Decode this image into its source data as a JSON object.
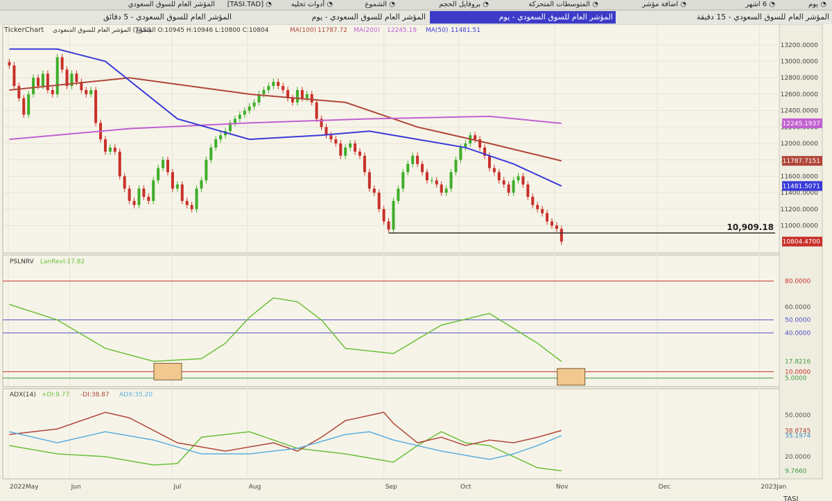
{
  "toolbar": {
    "items": [
      {
        "label": "يوم",
        "icon": "clock-icon"
      },
      {
        "label": "6 اشهر",
        "icon": "range-icon"
      },
      {
        "label": "اضافة مؤشر",
        "icon": "add-indicator-icon"
      },
      {
        "label": "المتوسطات المتحركة",
        "icon": "moving-average-icon"
      },
      {
        "label": "بروفايل الحجم",
        "icon": "volume-profile-icon"
      },
      {
        "label": "الشموع",
        "icon": "candles-icon"
      },
      {
        "label": "أدوات تحليه",
        "icon": "tools-icon"
      },
      {
        "label": "[TASI.TAD]",
        "icon": "symbol-icon"
      },
      {
        "label": "المؤشر العام للسوق السعودي",
        "icon": ""
      }
    ]
  },
  "tabs": [
    {
      "label": "المؤشر العام للسوق السعودي - 15 دقيقة",
      "active": false
    },
    {
      "label": "المؤشر العام للسوق السعودي - يوم",
      "active": true
    },
    {
      "label": "المؤشر العام للسوق السعودي - يوم",
      "active": false
    },
    {
      "label": "المؤشر العام للسوق السعودي - 5 دقائق",
      "active": false
    }
  ],
  "colors": {
    "price_up": "#3fae2a",
    "price_down": "#c8302a",
    "ma50": "#3a3ad8",
    "ma100": "#b0453a",
    "ma200": "#c060d0",
    "rsi": "#6abf3a",
    "di_plus": "#6abf3a",
    "di_minus": "#b0453a",
    "adx": "#5aaee0"
  },
  "chart_data": [
    {
      "type": "candlestick",
      "title": "TickerChart",
      "symbol_label": "المؤشر العام للسوق السعودي (TASI)",
      "ohlc_label": "الشموع O:10945 H:10946 L:10800 C:10804",
      "x_ticks": [
        "2022May",
        "Jun",
        "Jul",
        "Aug",
        "Sep",
        "Oct",
        "Nov",
        "Dec",
        "2023Jan"
      ],
      "y_ticks": [
        "13200.0000",
        "13000.0000",
        "12800.0000",
        "12600.0000",
        "12400.0000",
        "12200.0000",
        "12000.0000",
        "11800.0000",
        "11600.0000",
        "11400.0000",
        "11200.0000",
        "11000.0000"
      ],
      "ylim": [
        10700,
        13300
      ],
      "close": [
        12950,
        12700,
        12550,
        12350,
        12600,
        12800,
        12700,
        12850,
        12650,
        12600,
        13050,
        12900,
        12700,
        12850,
        12750,
        12650,
        12600,
        12650,
        12250,
        12050,
        11900,
        11950,
        11900,
        11600,
        11450,
        11300,
        11250,
        11450,
        11350,
        11300,
        11550,
        11700,
        11800,
        11650,
        11450,
        11500,
        11300,
        11250,
        11200,
        11450,
        11550,
        11800,
        11950,
        12050,
        12100,
        12150,
        12250,
        12300,
        12350,
        12400,
        12450,
        12500,
        12600,
        12650,
        12700,
        12750,
        12700,
        12650,
        12550,
        12500,
        12650,
        12550,
        12600,
        12500,
        12300,
        12200,
        12100,
        12050,
        12000,
        11850,
        11950,
        12000,
        11900,
        11850,
        11650,
        11450,
        11400,
        11200,
        11050,
        10950,
        11300,
        11450,
        11650,
        11750,
        11850,
        11750,
        11650,
        11550,
        11550,
        11500,
        11400,
        11450,
        11650,
        11800,
        11950,
        12000,
        12100,
        12050,
        11950,
        11850,
        11700,
        11650,
        11550,
        11500,
        11400,
        11550,
        11600,
        11500,
        11350,
        11250,
        11200,
        11150,
        11050,
        11000,
        10960,
        10804
      ],
      "series": [
        {
          "name": "MA(100)",
          "value_label": "11787.72",
          "color": "#b0453a",
          "last": 11787.72,
          "x": [
            0,
            25,
            50,
            70,
            85,
            100,
            115
          ],
          "y": [
            12650,
            12800,
            12600,
            12500,
            12200,
            12000,
            11787.72
          ]
        },
        {
          "name": "MA(200)",
          "value_label": "12245.19",
          "color": "#c060d0",
          "last": 12245.19,
          "x": [
            0,
            25,
            50,
            75,
            100,
            115
          ],
          "y": [
            12050,
            12180,
            12250,
            12300,
            12330,
            12245.19
          ]
        },
        {
          "name": "MA(50)",
          "value_label": "11481.51",
          "color": "#3a3ad8",
          "last": 11481.51,
          "x": [
            0,
            10,
            20,
            35,
            50,
            65,
            75,
            85,
            95,
            105,
            115
          ],
          "y": [
            13150,
            13150,
            13000,
            12300,
            12050,
            12100,
            12150,
            12050,
            11950,
            11750,
            11481.51
          ]
        }
      ],
      "price_labels": [
        {
          "value": 12245.19,
          "text": "12245.1937",
          "color": "#c060d0"
        },
        {
          "value": 11787.72,
          "text": "11787.7151",
          "color": "#b0453a"
        },
        {
          "value": 11481.51,
          "text": "11481.5071",
          "color": "#3a3ad8"
        },
        {
          "value": 10804.47,
          "text": "10804.4700",
          "color": "#c8302a"
        }
      ],
      "support_line": {
        "value": 10909.18,
        "label": "10,909.18"
      }
    },
    {
      "type": "line",
      "title": "PSLNRV",
      "series_label": "LanRevl:17.82",
      "y_ticks": [
        "80.0000",
        "60.0000",
        "50.0000",
        "40.0000",
        "17.8216",
        "10.0000",
        "5.0000"
      ],
      "ylim": [
        0,
        90
      ],
      "levels": [
        80,
        50,
        40,
        10,
        5
      ],
      "level_colors": [
        "#c8302a",
        "#5050c8",
        "#5050c8",
        "#c8302a",
        "#3f9a3f"
      ],
      "series": [
        {
          "name": "LanRevl",
          "color": "#6abf3a",
          "last": 17.82,
          "x": [
            0,
            10,
            20,
            30,
            40,
            45,
            50,
            55,
            60,
            65,
            70,
            80,
            90,
            100,
            110,
            115
          ],
          "y": [
            62,
            50,
            28,
            18,
            20,
            32,
            52,
            67,
            64,
            50,
            28,
            24,
            46,
            55,
            32,
            17.82
          ]
        }
      ],
      "highlights": [
        {
          "x": 33,
          "y": 10
        },
        {
          "x": 117,
          "y": 6
        }
      ],
      "value_label_colors": [
        "#c8302a",
        "#555555",
        "#5050c8",
        "#5050c8",
        "#3f9a3f",
        "#c8302a",
        "#3f9a3f"
      ]
    },
    {
      "type": "line",
      "title": "ADX(14)",
      "series_labels": [
        {
          "text": "+DI:9.77",
          "color": "#6abf3a"
        },
        {
          "text": "-DI:38.87",
          "color": "#b0453a"
        },
        {
          "text": "ADX:35.20",
          "color": "#5aaee0"
        }
      ],
      "y_ticks": [
        "50.0000",
        "38.8745",
        "35.1974",
        "20.0000",
        "9.7660"
      ],
      "ylim": [
        5,
        60
      ],
      "series": [
        {
          "name": "+DI",
          "color": "#6abf3a",
          "last": 9.77,
          "x": [
            0,
            10,
            20,
            30,
            35,
            40,
            50,
            60,
            70,
            80,
            85,
            90,
            95,
            100,
            110,
            115
          ],
          "y": [
            28,
            22,
            20,
            14,
            15,
            34,
            38,
            26,
            22,
            16,
            28,
            38,
            30,
            28,
            12,
            9.77
          ]
        },
        {
          "name": "-DI",
          "color": "#b0453a",
          "last": 38.87,
          "x": [
            0,
            10,
            20,
            25,
            35,
            45,
            55,
            60,
            65,
            70,
            78,
            80,
            85,
            90,
            95,
            100,
            105,
            110,
            115
          ],
          "y": [
            36,
            40,
            52,
            48,
            30,
            24,
            30,
            24,
            34,
            46,
            52,
            44,
            30,
            34,
            28,
            32,
            30,
            34,
            38.87
          ]
        },
        {
          "name": "ADX",
          "color": "#5aaee0",
          "last": 35.2,
          "x": [
            0,
            10,
            20,
            30,
            40,
            50,
            60,
            70,
            75,
            80,
            90,
            100,
            105,
            110,
            115
          ],
          "y": [
            38,
            30,
            38,
            32,
            22,
            22,
            26,
            36,
            38,
            32,
            24,
            18,
            22,
            28,
            35.2
          ]
        }
      ],
      "value_label_colors": [
        "#555555",
        "#b0453a",
        "#3a8ac8",
        "#555555",
        "#3f9a3f"
      ]
    }
  ],
  "status": {
    "symbol": "TASI"
  }
}
